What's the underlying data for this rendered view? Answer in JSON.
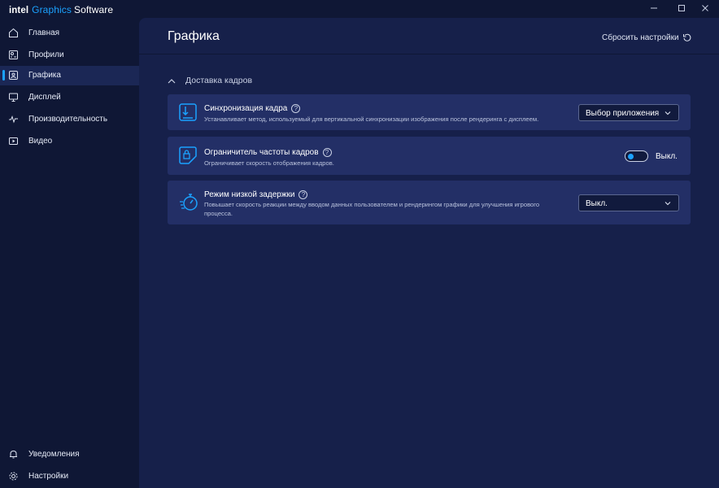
{
  "window": {
    "brand_intel": "intel",
    "brand_graphics": "Graphics",
    "brand_software": "Software",
    "minimize_icon": "minimize-icon",
    "maximize_icon": "maximize-icon",
    "close_icon": "close-icon"
  },
  "sidebar": {
    "items": [
      {
        "label": "Главная",
        "icon": "home-icon"
      },
      {
        "label": "Профили",
        "icon": "profile-icon"
      },
      {
        "label": "Графика",
        "icon": "graphics-icon",
        "active": true
      },
      {
        "label": "Дисплей",
        "icon": "display-icon"
      },
      {
        "label": "Производительность",
        "icon": "performance-icon"
      },
      {
        "label": "Видео",
        "icon": "video-icon"
      }
    ],
    "bottom": [
      {
        "label": "Уведомления",
        "icon": "bell-icon"
      },
      {
        "label": "Настройки",
        "icon": "gear-icon"
      }
    ]
  },
  "header": {
    "title": "Графика",
    "reset_label": "Сбросить настройки"
  },
  "section": {
    "title": "Доставка кадров",
    "expanded": true
  },
  "settings": [
    {
      "title": "Синхронизация кадра",
      "description": "Устанавливает метод, используемый для вертикальной синхронизации изображения после рендеринга с дисплеем.",
      "control": "dropdown",
      "value": "Выбор приложения"
    },
    {
      "title": "Ограничитель частоты кадров",
      "description": "Ограничивает скорость отображения кадров.",
      "control": "toggle",
      "value": "Выкл.",
      "on": false
    },
    {
      "title": "Режим низкой задержки",
      "description": "Повышает скорость реакции между вводом данных пользователем и рендерингом графики для улучшения игрового процесса.",
      "control": "dropdown",
      "value": "Выкл."
    }
  ],
  "help_glyph": "?",
  "colors": {
    "background": "#0f1735",
    "panel": "#16204a",
    "card": "#232f66",
    "accent": "#1ba2ff"
  }
}
